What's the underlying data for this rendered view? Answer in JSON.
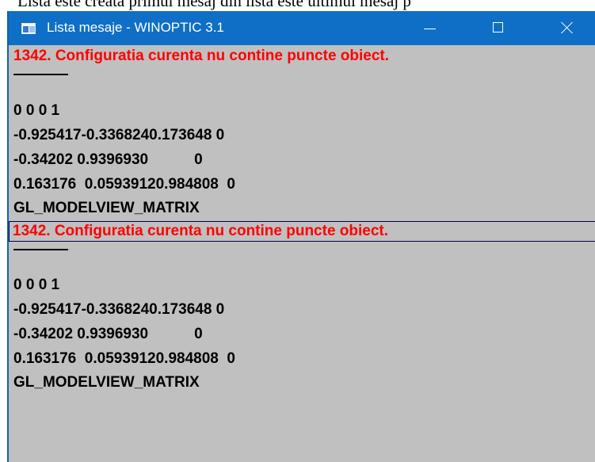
{
  "document_text": "Lista este creata primul mesaj din lista este ultimul mesaj p",
  "window": {
    "title": "Lista mesaje - WINOPTIC 3.1",
    "icon": "application-window-icon",
    "buttons": {
      "minimize": "minimize-icon",
      "maximize": "maximize-icon",
      "close": "close-icon"
    }
  },
  "messages": {
    "group_1": {
      "error": "1342. Configuratia curenta nu contine puncte obiect.",
      "row_1": "0 0 0 1",
      "row_2": "-0.925417-0.3368240.173648 0",
      "row_3": "-0.34202 0.9396930           0",
      "row_4": "0.163176  0.05939120.984808  0",
      "label": "GL_MODELVIEW_MATRIX"
    },
    "group_2": {
      "error": "1342. Configuratia curenta nu contine puncte obiect.",
      "row_1": "0 0 0 1",
      "row_2": "-0.925417-0.3368240.173648 0",
      "row_3": "-0.34202 0.9396930           0",
      "row_4": "0.163176  0.05939120.984808  0",
      "label": "GL_MODELVIEW_MATRIX"
    }
  },
  "colors": {
    "titlebar": "#0f6fc6",
    "list_background": "#c0c0c0",
    "error_text": "#ff0000"
  }
}
